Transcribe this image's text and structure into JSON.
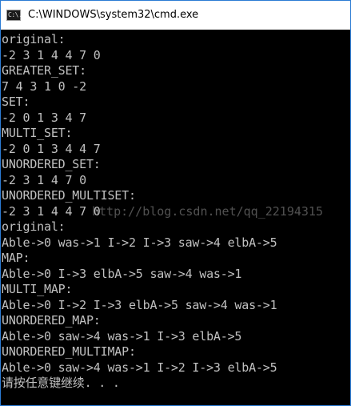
{
  "window": {
    "title": "C:\\WINDOWS\\system32\\cmd.exe",
    "icon_glyph": "C:\\."
  },
  "console": {
    "lines": [
      "original:",
      "-2 3 1 4 4 7 0",
      "GREATER_SET:",
      "7 4 3 1 0 -2",
      "SET:",
      "-2 0 1 3 4 7",
      "MULTI_SET:",
      "-2 0 1 3 4 4 7",
      "UNORDERED_SET:",
      "-2 3 1 4 7 0",
      "UNORDERED_MULTISET:",
      "-2 3 1 4 4 7 0",
      "original:",
      "Able->0 was->1 I->2 I->3 saw->4 elbA->5",
      "MAP:",
      "Able->0 I->3 elbA->5 saw->4 was->1",
      "MULTI_MAP:",
      "Able->0 I->2 I->3 elbA->5 saw->4 was->1",
      "UNORDERED_MAP:",
      "Able->0 saw->4 was->1 I->3 elbA->5",
      "UNORDERED_MULTIMAP:",
      "Able->0 saw->4 was->1 I->2 I->3 elbA->5",
      "请按任意键继续. . ."
    ],
    "watermark": "http://blog.csdn.net/qq_22194315"
  },
  "colors": {
    "console_background": "#000000",
    "console_text": "#c0c0c0",
    "titlebar_background": "#ffffff",
    "window_border": "#2b7bd4"
  }
}
